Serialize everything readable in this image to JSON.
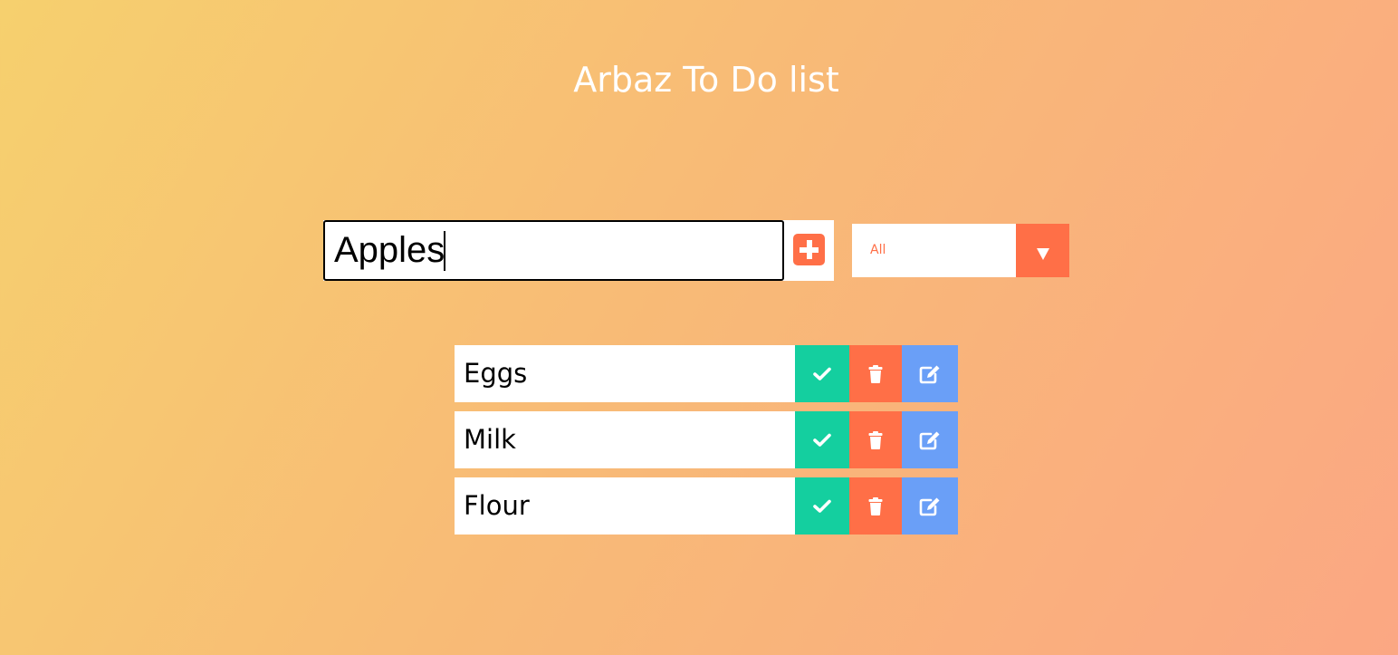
{
  "app": {
    "title": "Arbaz To Do list"
  },
  "input": {
    "value": "Apples",
    "placeholder": ""
  },
  "add_button": {
    "icon": "plus-square-icon"
  },
  "filter": {
    "selected": "All",
    "icon": "triangle-down-icon"
  },
  "todos": [
    {
      "text": "Eggs"
    },
    {
      "text": "Milk"
    },
    {
      "text": "Flour"
    }
  ],
  "item_actions": {
    "complete_icon": "check-icon",
    "delete_icon": "trash-icon",
    "edit_icon": "edit-icon"
  },
  "colors": {
    "accent": "#ff6f47",
    "complete": "#14cf9f",
    "edit": "#6a9ff7",
    "background_start": "#f6d06e",
    "background_end": "#fba783"
  }
}
